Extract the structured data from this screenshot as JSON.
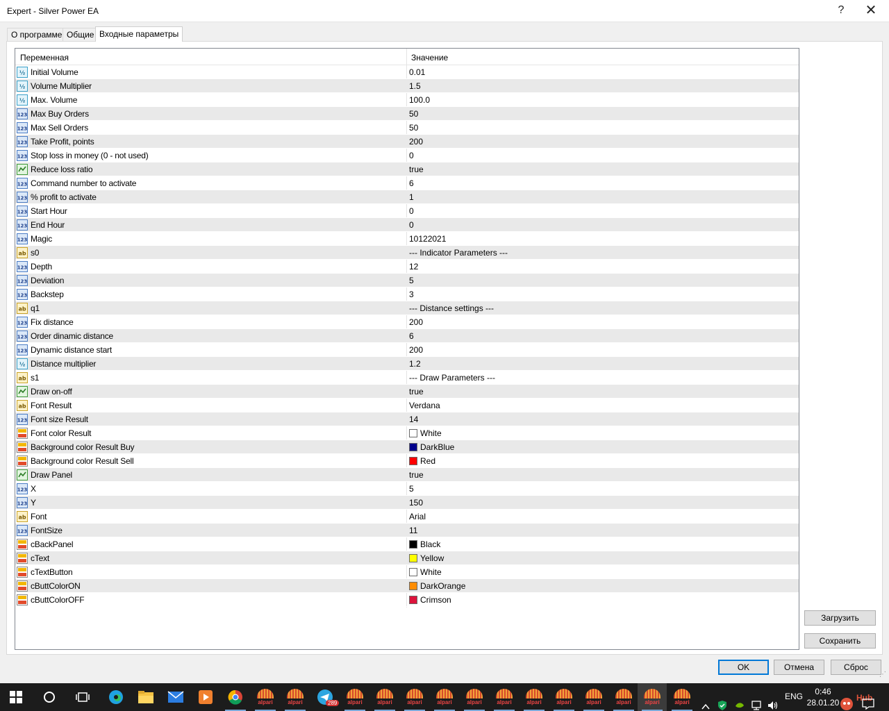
{
  "window": {
    "title": "Expert - Silver Power EA",
    "help_glyph": "?",
    "close_glyph": "✕"
  },
  "tabs": [
    {
      "label": "О программе"
    },
    {
      "label": "Общие"
    },
    {
      "label": "Входные параметры",
      "active": true
    }
  ],
  "grid": {
    "col_variable": "Переменная",
    "col_value": "Значение",
    "rows": [
      {
        "icon": "double-icon",
        "name": "Initial Volume",
        "value": "0.01"
      },
      {
        "icon": "double-icon",
        "name": "Volume Multiplier",
        "value": "1.5"
      },
      {
        "icon": "double-icon",
        "name": "Max. Volume",
        "value": "100.0"
      },
      {
        "icon": "integer-icon",
        "name": "Max Buy Orders",
        "value": "50"
      },
      {
        "icon": "integer-icon",
        "name": "Max Sell Orders",
        "value": "50"
      },
      {
        "icon": "integer-icon",
        "name": "Take Profit, points",
        "value": "200"
      },
      {
        "icon": "integer-icon",
        "name": "Stop loss in money (0 - not used)",
        "value": "0"
      },
      {
        "icon": "bool-icon",
        "name": "Reduce loss ratio",
        "value": "true"
      },
      {
        "icon": "integer-icon",
        "name": "Command number to activate",
        "value": "6"
      },
      {
        "icon": "integer-icon",
        "name": "% profit to activate",
        "value": "1"
      },
      {
        "icon": "integer-icon",
        "name": "Start Hour",
        "value": "0"
      },
      {
        "icon": "integer-icon",
        "name": "End Hour",
        "value": "0"
      },
      {
        "icon": "integer-icon",
        "name": "Magic",
        "value": "10122021"
      },
      {
        "icon": "string-icon",
        "name": "s0",
        "value": "--- Indicator Parameters ---"
      },
      {
        "icon": "integer-icon",
        "name": "Depth",
        "value": "12"
      },
      {
        "icon": "integer-icon",
        "name": "Deviation",
        "value": "5"
      },
      {
        "icon": "integer-icon",
        "name": "Backstep",
        "value": "3"
      },
      {
        "icon": "string-icon",
        "name": "q1",
        "value": "--- Distance settings ---"
      },
      {
        "icon": "integer-icon",
        "name": "Fix distance",
        "value": "200"
      },
      {
        "icon": "integer-icon",
        "name": "Order dinamic distance",
        "value": "6"
      },
      {
        "icon": "integer-icon",
        "name": "Dynamic distance start",
        "value": "200"
      },
      {
        "icon": "double-icon",
        "name": "Distance multiplier",
        "value": "1.2"
      },
      {
        "icon": "string-icon",
        "name": "s1",
        "value": "--- Draw Parameters ---"
      },
      {
        "icon": "bool-icon",
        "name": "Draw on-off",
        "value": "true"
      },
      {
        "icon": "string-icon",
        "name": "Font Result",
        "value": "Verdana"
      },
      {
        "icon": "integer-icon",
        "name": "Font size Result",
        "value": "14"
      },
      {
        "icon": "color-icon",
        "name": "Font color Result",
        "value": "White",
        "color": "#ffffff"
      },
      {
        "icon": "color-icon",
        "name": "Background color Result Buy",
        "value": "DarkBlue",
        "color": "#00008b"
      },
      {
        "icon": "color-icon",
        "name": "Background color Result Sell",
        "value": "Red",
        "color": "#ff0000"
      },
      {
        "icon": "bool-icon",
        "name": "Draw Panel",
        "value": "true"
      },
      {
        "icon": "integer-icon",
        "name": "X",
        "value": "5"
      },
      {
        "icon": "integer-icon",
        "name": "Y",
        "value": "150"
      },
      {
        "icon": "string-icon",
        "name": "Font",
        "value": "Arial"
      },
      {
        "icon": "integer-icon",
        "name": "FontSize",
        "value": "11"
      },
      {
        "icon": "color-icon",
        "name": "cBackPanel",
        "value": "Black",
        "color": "#000000"
      },
      {
        "icon": "color-icon",
        "name": "cText",
        "value": "Yellow",
        "color": "#ffff00"
      },
      {
        "icon": "color-icon",
        "name": "cTextButton",
        "value": "White",
        "color": "#ffffff"
      },
      {
        "icon": "color-icon",
        "name": "cButtColorON",
        "value": "DarkOrange",
        "color": "#ff8c00"
      },
      {
        "icon": "color-icon",
        "name": "cButtColorOFF",
        "value": "Crimson",
        "color": "#dc143c"
      }
    ]
  },
  "side_buttons": {
    "load": "Загрузить",
    "save": "Сохранить"
  },
  "footer": {
    "ok": "OK",
    "cancel": "Отмена",
    "reset": "Сброс"
  },
  "taskbar": {
    "telegram_badge": "289",
    "alpari_label": "alpari",
    "lang": "ENG",
    "time": "0:46",
    "date": "28.01.20",
    "watermark": "Hub"
  }
}
